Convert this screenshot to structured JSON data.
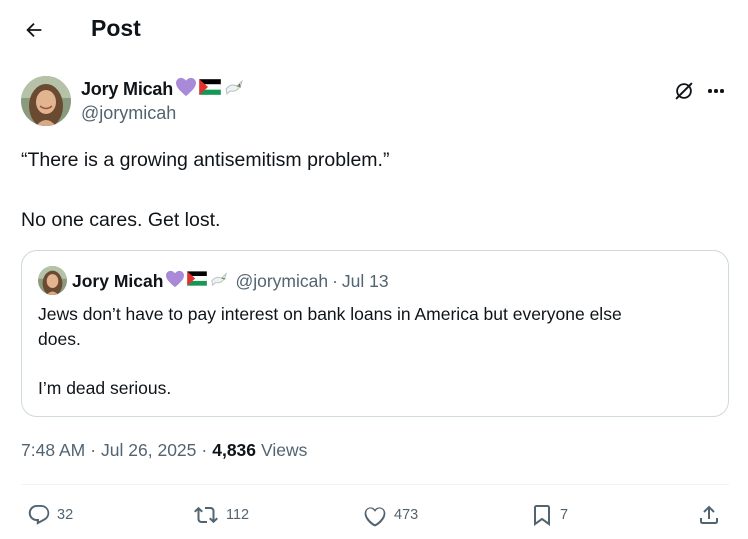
{
  "header": {
    "title": "Post",
    "back_icon": "arrow-left-icon"
  },
  "post": {
    "author_name": "Jory Micah",
    "author_handle": "@jorymicah",
    "name_emojis": [
      "purple-heart-icon",
      "palestine-flag-icon",
      "dove-icon"
    ],
    "text_line1": "“There is a growing antisemitism problem.”",
    "text_line2": "No one cares. Get lost."
  },
  "quote": {
    "author_name": "Jory Micah",
    "author_handle": "@jorymicah",
    "separator": "·",
    "date": "Jul 13",
    "text_line1": "Jews don’t have to pay interest on bank loans in America but everyone else",
    "text_line2": "does.",
    "text_line3": "I’m dead serious."
  },
  "meta": {
    "time": "7:48 AM",
    "separator": "·",
    "date": "Jul 26, 2025",
    "views_count": "4,836",
    "views_label": "Views"
  },
  "actions": {
    "replies": "32",
    "reposts": "112",
    "likes": "473",
    "bookmarks": "7"
  },
  "colors": {
    "text_primary": "#0f1419",
    "text_secondary": "#536471",
    "border": "#cfd9de",
    "divider": "#eff3f4",
    "heart_emoji": "#a98ad9"
  }
}
